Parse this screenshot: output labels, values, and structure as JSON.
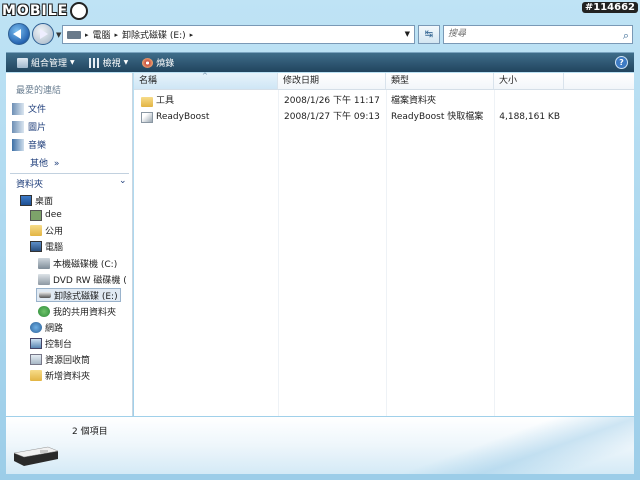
{
  "watermark": {
    "brand": "MOBILE",
    "tag": "#114662"
  },
  "address": {
    "crumbs": [
      "電腦",
      "卸除式磁碟 (E:)"
    ],
    "search_placeholder": "搜尋"
  },
  "toolbar": {
    "organize": "組合管理",
    "views": "檢視",
    "burn": "燒錄",
    "help": "?"
  },
  "left_pane": {
    "favorites_header": "最愛的連結",
    "favorites": [
      {
        "label": "文件",
        "icon": "documents-icon"
      },
      {
        "label": "圖片",
        "icon": "pictures-icon"
      },
      {
        "label": "音樂",
        "icon": "music-icon"
      }
    ],
    "more": "其他",
    "more_arrow": "»",
    "folders_header": "資料夾",
    "tree": [
      {
        "label": "桌面",
        "icon": "desktop-icon"
      },
      {
        "label": "dee",
        "icon": "user-folder-icon"
      },
      {
        "label": "公用",
        "icon": "folder-icon"
      },
      {
        "label": "電腦",
        "icon": "computer-icon"
      },
      {
        "label": "本機磁碟機 (C:)",
        "icon": "hard-drive-icon"
      },
      {
        "label": "DVD RW 磁碟機 (",
        "icon": "dvd-drive-icon"
      },
      {
        "label": "卸除式磁碟 (E:)",
        "icon": "removable-drive-icon"
      },
      {
        "label": "我的共用資料夾",
        "icon": "shared-folder-icon"
      },
      {
        "label": "網路",
        "icon": "network-icon"
      },
      {
        "label": "控制台",
        "icon": "control-panel-icon"
      },
      {
        "label": "資源回收筒",
        "icon": "recycle-bin-icon"
      },
      {
        "label": "新增資料夾",
        "icon": "folder-icon"
      }
    ]
  },
  "columns": [
    "名稱",
    "修改日期",
    "類型",
    "大小"
  ],
  "files": [
    {
      "name": "工具",
      "date": "2008/1/26 下午 11:17",
      "type": "檔案資料夾",
      "size": "",
      "icon": "folder-icon"
    },
    {
      "name": "ReadyBoost",
      "date": "2008/1/27 下午 09:13",
      "type": "ReadyBoost 快取檔案",
      "size": "4,188,161 KB",
      "icon": "readyboost-file-icon"
    }
  ],
  "details": {
    "count": "2 個項目"
  },
  "colors": {
    "toolbar": "#2b516c",
    "selection": "#e1eaf3",
    "link": "#1e3d7a"
  }
}
